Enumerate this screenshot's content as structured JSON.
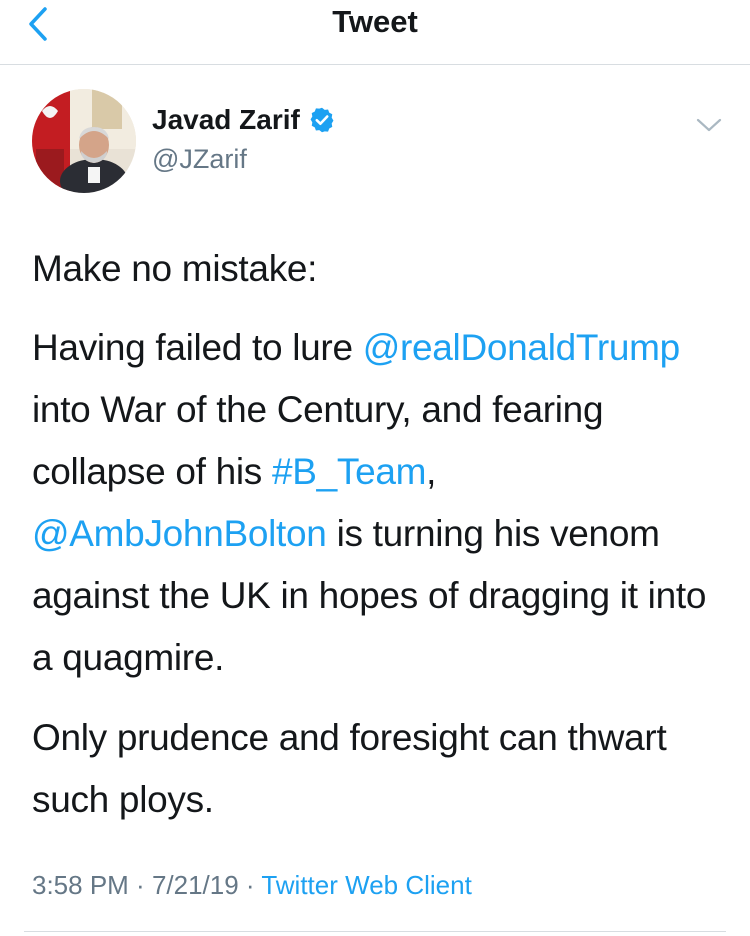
{
  "nav": {
    "title": "Tweet"
  },
  "tweet": {
    "author": {
      "name": "Javad Zarif",
      "handle": "@JZarif",
      "verified": true
    },
    "paragraph1": "Make no mistake:",
    "paragraph2": {
      "t1": "Having failed to lure ",
      "mention1": "@realDonaldTrump",
      "t2": " into War of the Century, and fearing collapse of his ",
      "hashtag": "#B_Team",
      "t3": ", ",
      "mention2": "@AmbJohnBolton",
      "t4": " is turning his venom against the UK in hopes of dragging it into a quagmire."
    },
    "paragraph3": "Only prudence and foresight can thwart such ploys.",
    "meta": {
      "time": "3:58 PM",
      "sep1": " · ",
      "date": "7/21/19",
      "sep2": " · ",
      "client": "Twitter Web Client"
    }
  },
  "colors": {
    "accent": "#1da1f2",
    "text": "#14171a",
    "secondary": "#657786",
    "divider": "#d8dde1"
  },
  "icons": {
    "back": "chevron-left-icon",
    "verified": "verified-badge-icon",
    "more": "chevron-down-icon"
  }
}
